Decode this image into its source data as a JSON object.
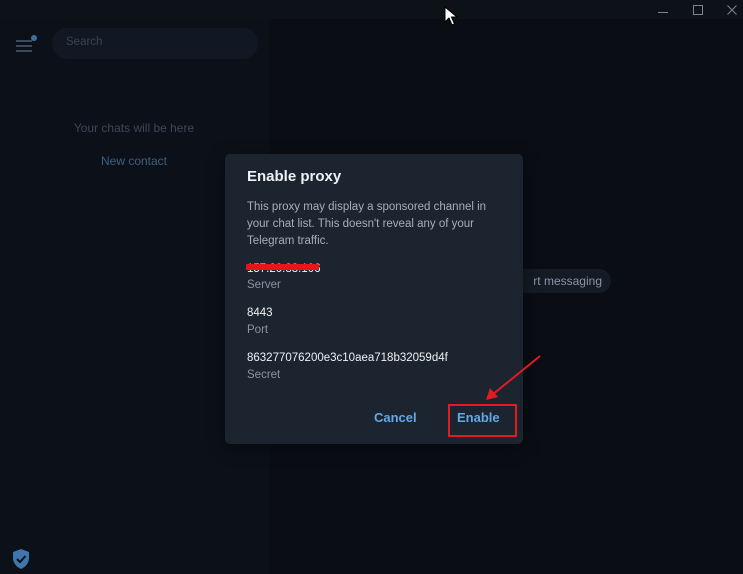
{
  "window": {
    "controls": {
      "minimize_icon": "minimize-icon",
      "maximize_icon": "maximize-icon",
      "close_icon": "close-icon"
    }
  },
  "sidebar": {
    "search": {
      "placeholder": "Search"
    },
    "empty_text": "Your chats will be here",
    "new_contact": "New contact",
    "icons": {
      "menu": "hamburger-menu-icon",
      "shield": "shield-check-icon"
    }
  },
  "main": {
    "start_messaging_partial": "rt messaging"
  },
  "dialog": {
    "title": "Enable proxy",
    "description": "This proxy may display a sponsored channel in your chat list. This doesn't reveal any of your Telegram traffic.",
    "server": {
      "value": "157.20.83.106",
      "label": "Server"
    },
    "port": {
      "value": "8443",
      "label": "Port"
    },
    "secret": {
      "value": "863277076200e3c10aea718b32059d4f",
      "label": "Secret"
    },
    "cancel_label": "Cancel",
    "enable_label": "Enable"
  },
  "colors": {
    "accent": "#64a8e8",
    "dialog_bg": "#1c242f",
    "annotation_red": "#e21b23"
  }
}
